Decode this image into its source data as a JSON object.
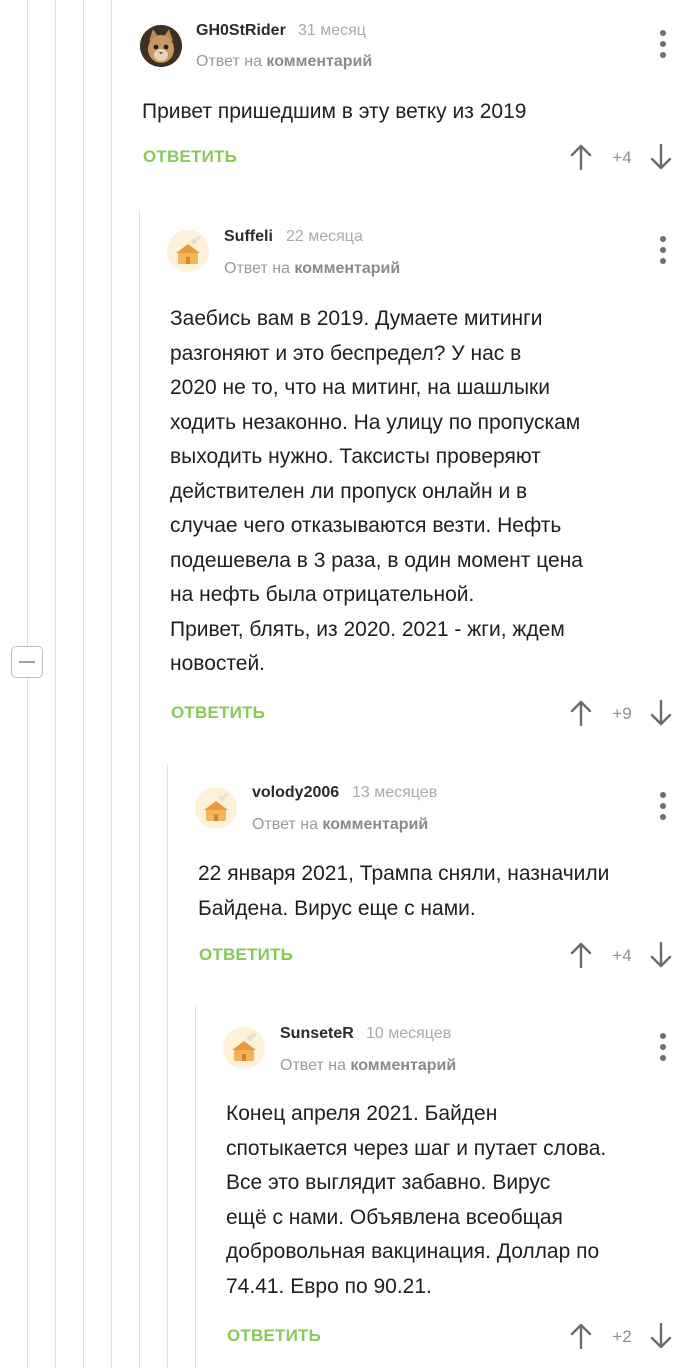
{
  "comments": [
    {
      "author": "GH0StRider",
      "time": "31 месяц",
      "reply_prefix": "Ответ на",
      "reply_target": "комментарий",
      "text": "Привет пришедшим в эту ветку из 2019",
      "reply_label": "ОТВЕТИТЬ",
      "rating": "+4",
      "avatar": "cat-avatar"
    },
    {
      "author": "Suffeli",
      "time": "22 месяца",
      "reply_prefix": "Ответ на",
      "reply_target": "комментарий",
      "text": "Заебись вам в 2019. Думаете митинги\nразгоняют и это беспредел? У нас в\n2020 не то, что на митинг, на шашлыки\nходить незаконно. На улицу по пропускам\nвыходить нужно. Таксисты проверяют\nдействителен ли пропуск онлайн и в\nслучае чего отказываются везти. Нефть\nподешевела в 3 раза, в один момент цена\nна нефть была отрицательной.\nПривет, блять, из 2020. 2021 - жги, ждем\nновостей.",
      "reply_label": "ОТВЕТИТЬ",
      "rating": "+9",
      "avatar": "default-avatar"
    },
    {
      "author": "volody2006",
      "time": "13 месяцев",
      "reply_prefix": "Ответ на",
      "reply_target": "комментарий",
      "text": "22 января 2021, Трампа сняли, назначили\nБайдена. Вирус еще с нами.",
      "reply_label": "ОТВЕТИТЬ",
      "rating": "+4",
      "avatar": "default-avatar"
    },
    {
      "author": "SunseteR",
      "time": "10 месяцев",
      "reply_prefix": "Ответ на",
      "reply_target": "комментарий",
      "text": "Конец апреля 2021. Байден\nспотыкается через шаг и путает слова.\nВсе это выглядит забавно. Вирус\nещё с нами. Объявлена всеобщая\nдобровольная вакцинация. Доллар по\n74.41. Евро по 90.21.",
      "reply_label": "ОТВЕТИТЬ",
      "rating": "+2",
      "avatar": "default-avatar"
    }
  ],
  "colors": {
    "accent_green": "#8ac858",
    "thread_line": "#e2e2e2",
    "muted_text": "#9a9a9a"
  },
  "icons": [
    "collapse-icon",
    "more-icon",
    "arrow-up-icon",
    "arrow-down-icon"
  ]
}
